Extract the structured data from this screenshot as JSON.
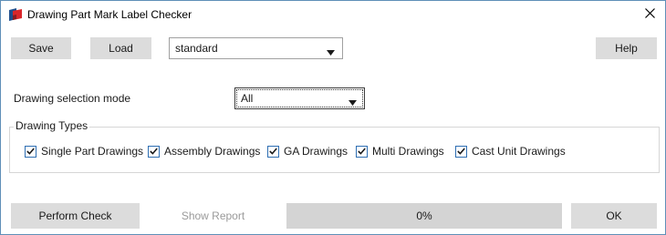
{
  "window": {
    "title": "Drawing Part Mark Label Checker",
    "close_icon": "close-icon"
  },
  "toolbar": {
    "save_label": "Save",
    "load_label": "Load",
    "preset_value": "standard",
    "help_label": "Help"
  },
  "selection_mode": {
    "label": "Drawing selection mode",
    "value": "All"
  },
  "drawing_types": {
    "title": "Drawing Types",
    "items": [
      {
        "label": "Single Part Drawings",
        "checked": true
      },
      {
        "label": "Assembly Drawings",
        "checked": true
      },
      {
        "label": "GA Drawings",
        "checked": true
      },
      {
        "label": "Multi Drawings",
        "checked": true
      },
      {
        "label": "Cast Unit Drawings",
        "checked": true
      }
    ]
  },
  "footer": {
    "perform_check_label": "Perform Check",
    "show_report_label": "Show Report",
    "progress_text": "0%",
    "progress_value": 0,
    "ok_label": "OK"
  },
  "colors": {
    "accent": "#2f6fb3",
    "button_bg": "#dcdcdc",
    "progress_bg": "#d4d4d4",
    "window_border": "#5f8fb8"
  }
}
